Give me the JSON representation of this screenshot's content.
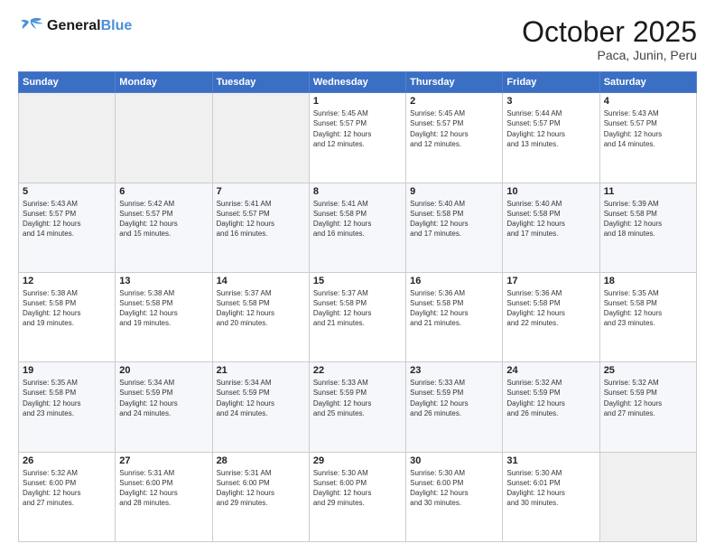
{
  "logo": {
    "line1": "General",
    "line2": "Blue"
  },
  "title": "October 2025",
  "location": "Paca, Junin, Peru",
  "days_of_week": [
    "Sunday",
    "Monday",
    "Tuesday",
    "Wednesday",
    "Thursday",
    "Friday",
    "Saturday"
  ],
  "weeks": [
    [
      {
        "num": "",
        "info": ""
      },
      {
        "num": "",
        "info": ""
      },
      {
        "num": "",
        "info": ""
      },
      {
        "num": "1",
        "info": "Sunrise: 5:45 AM\nSunset: 5:57 PM\nDaylight: 12 hours\nand 12 minutes."
      },
      {
        "num": "2",
        "info": "Sunrise: 5:45 AM\nSunset: 5:57 PM\nDaylight: 12 hours\nand 12 minutes."
      },
      {
        "num": "3",
        "info": "Sunrise: 5:44 AM\nSunset: 5:57 PM\nDaylight: 12 hours\nand 13 minutes."
      },
      {
        "num": "4",
        "info": "Sunrise: 5:43 AM\nSunset: 5:57 PM\nDaylight: 12 hours\nand 14 minutes."
      }
    ],
    [
      {
        "num": "5",
        "info": "Sunrise: 5:43 AM\nSunset: 5:57 PM\nDaylight: 12 hours\nand 14 minutes."
      },
      {
        "num": "6",
        "info": "Sunrise: 5:42 AM\nSunset: 5:57 PM\nDaylight: 12 hours\nand 15 minutes."
      },
      {
        "num": "7",
        "info": "Sunrise: 5:41 AM\nSunset: 5:57 PM\nDaylight: 12 hours\nand 16 minutes."
      },
      {
        "num": "8",
        "info": "Sunrise: 5:41 AM\nSunset: 5:58 PM\nDaylight: 12 hours\nand 16 minutes."
      },
      {
        "num": "9",
        "info": "Sunrise: 5:40 AM\nSunset: 5:58 PM\nDaylight: 12 hours\nand 17 minutes."
      },
      {
        "num": "10",
        "info": "Sunrise: 5:40 AM\nSunset: 5:58 PM\nDaylight: 12 hours\nand 17 minutes."
      },
      {
        "num": "11",
        "info": "Sunrise: 5:39 AM\nSunset: 5:58 PM\nDaylight: 12 hours\nand 18 minutes."
      }
    ],
    [
      {
        "num": "12",
        "info": "Sunrise: 5:38 AM\nSunset: 5:58 PM\nDaylight: 12 hours\nand 19 minutes."
      },
      {
        "num": "13",
        "info": "Sunrise: 5:38 AM\nSunset: 5:58 PM\nDaylight: 12 hours\nand 19 minutes."
      },
      {
        "num": "14",
        "info": "Sunrise: 5:37 AM\nSunset: 5:58 PM\nDaylight: 12 hours\nand 20 minutes."
      },
      {
        "num": "15",
        "info": "Sunrise: 5:37 AM\nSunset: 5:58 PM\nDaylight: 12 hours\nand 21 minutes."
      },
      {
        "num": "16",
        "info": "Sunrise: 5:36 AM\nSunset: 5:58 PM\nDaylight: 12 hours\nand 21 minutes."
      },
      {
        "num": "17",
        "info": "Sunrise: 5:36 AM\nSunset: 5:58 PM\nDaylight: 12 hours\nand 22 minutes."
      },
      {
        "num": "18",
        "info": "Sunrise: 5:35 AM\nSunset: 5:58 PM\nDaylight: 12 hours\nand 23 minutes."
      }
    ],
    [
      {
        "num": "19",
        "info": "Sunrise: 5:35 AM\nSunset: 5:58 PM\nDaylight: 12 hours\nand 23 minutes."
      },
      {
        "num": "20",
        "info": "Sunrise: 5:34 AM\nSunset: 5:59 PM\nDaylight: 12 hours\nand 24 minutes."
      },
      {
        "num": "21",
        "info": "Sunrise: 5:34 AM\nSunset: 5:59 PM\nDaylight: 12 hours\nand 24 minutes."
      },
      {
        "num": "22",
        "info": "Sunrise: 5:33 AM\nSunset: 5:59 PM\nDaylight: 12 hours\nand 25 minutes."
      },
      {
        "num": "23",
        "info": "Sunrise: 5:33 AM\nSunset: 5:59 PM\nDaylight: 12 hours\nand 26 minutes."
      },
      {
        "num": "24",
        "info": "Sunrise: 5:32 AM\nSunset: 5:59 PM\nDaylight: 12 hours\nand 26 minutes."
      },
      {
        "num": "25",
        "info": "Sunrise: 5:32 AM\nSunset: 5:59 PM\nDaylight: 12 hours\nand 27 minutes."
      }
    ],
    [
      {
        "num": "26",
        "info": "Sunrise: 5:32 AM\nSunset: 6:00 PM\nDaylight: 12 hours\nand 27 minutes."
      },
      {
        "num": "27",
        "info": "Sunrise: 5:31 AM\nSunset: 6:00 PM\nDaylight: 12 hours\nand 28 minutes."
      },
      {
        "num": "28",
        "info": "Sunrise: 5:31 AM\nSunset: 6:00 PM\nDaylight: 12 hours\nand 29 minutes."
      },
      {
        "num": "29",
        "info": "Sunrise: 5:30 AM\nSunset: 6:00 PM\nDaylight: 12 hours\nand 29 minutes."
      },
      {
        "num": "30",
        "info": "Sunrise: 5:30 AM\nSunset: 6:00 PM\nDaylight: 12 hours\nand 30 minutes."
      },
      {
        "num": "31",
        "info": "Sunrise: 5:30 AM\nSunset: 6:01 PM\nDaylight: 12 hours\nand 30 minutes."
      },
      {
        "num": "",
        "info": ""
      }
    ]
  ]
}
